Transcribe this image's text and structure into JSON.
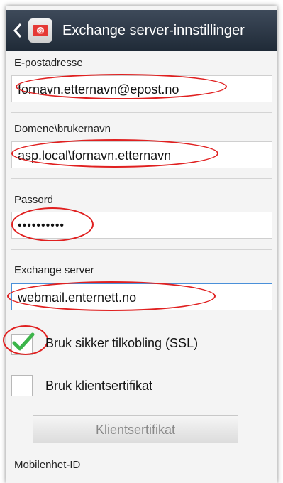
{
  "header": {
    "title": "Exchange server-innstillinger"
  },
  "form": {
    "email_label": "E-postadresse",
    "email_value": "fornavn.etternavn@epost.no",
    "domain_label": "Domene\\brukernavn",
    "domain_value": "asp.local\\fornavn.etternavn",
    "password_label": "Passord",
    "password_value": "••••••••••",
    "server_label": "Exchange server",
    "server_value": "webmail.enternett.no",
    "ssl_label": "Bruk sikker tilkobling (SSL)",
    "ssl_checked": true,
    "clientcert_label": "Bruk klientsertifikat",
    "clientcert_checked": false,
    "clientcert_button": "Klientsertifikat",
    "mobile_id_label": "Mobilenhet-ID"
  },
  "colors": {
    "annotation": "#e02020",
    "check": "#3cb54a",
    "titlebar": "#2b3542"
  }
}
